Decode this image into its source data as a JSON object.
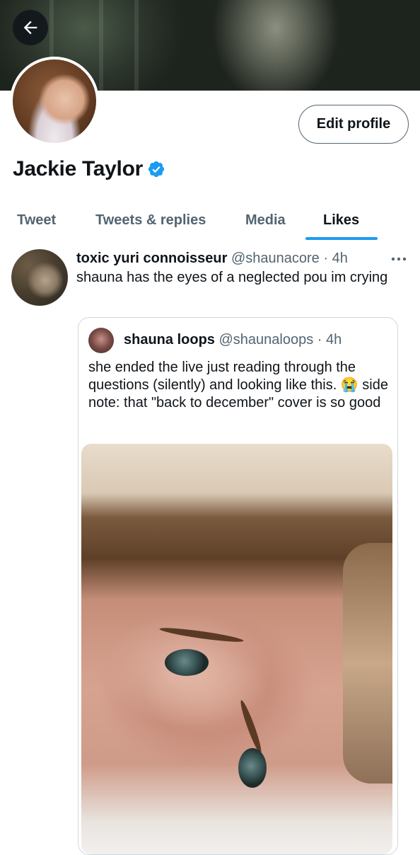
{
  "header": {
    "back_icon": "arrow-left-icon",
    "edit_profile_label": "Edit profile"
  },
  "profile": {
    "display_name": "Jackie Taylor",
    "verified_icon": "verified-badge-icon"
  },
  "tabs": [
    {
      "label": "Tweet",
      "active": false
    },
    {
      "label": "Tweets & replies",
      "active": false
    },
    {
      "label": "Media",
      "active": false
    },
    {
      "label": "Likes",
      "active": true
    }
  ],
  "tweet": {
    "display_name": "toxic yuri connoisseur",
    "handle": "@shaunacore",
    "separator": "·",
    "time": "4h",
    "text": "shauna has the eyes of a neglected pou im crying",
    "more_icon": "more-dots-icon",
    "quote": {
      "display_name": "shauna loops",
      "handle": "@shaunaloops",
      "separator": "·",
      "time": "4h",
      "text": "she ended the live just reading through the questions (silently) and looking like this. 😭 side note: that \"back to december\" cover is so good"
    }
  },
  "colors": {
    "accent": "#1d9bf0",
    "text_primary": "#0f1419",
    "text_secondary": "#536471",
    "border": "#cfd9de"
  }
}
